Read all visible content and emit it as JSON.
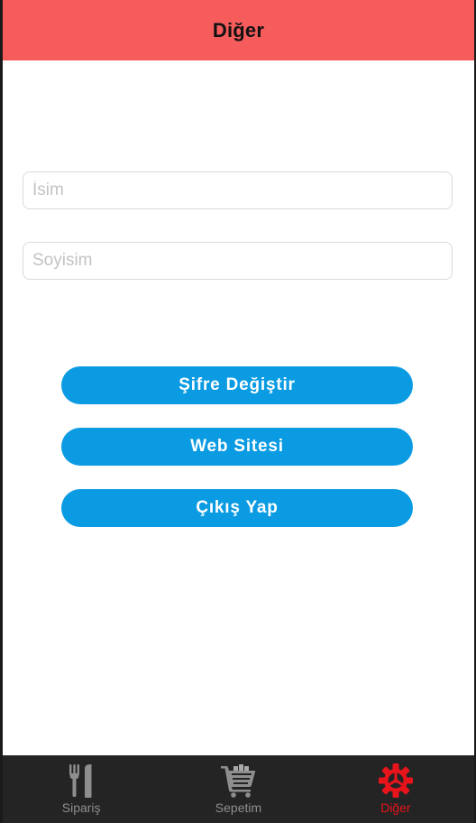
{
  "header": {
    "title": "Diğer"
  },
  "form": {
    "name": {
      "value": "",
      "placeholder": "İsim"
    },
    "surname": {
      "value": "",
      "placeholder": "Soyisim"
    }
  },
  "actions": {
    "change_password_label": "Şifre Değiştir",
    "website_label": "Web Sitesi",
    "logout_label": "Çıkış Yap"
  },
  "tabbar": {
    "items": [
      {
        "label": "Sipariş",
        "icon": "fork-knife-icon",
        "active": false
      },
      {
        "label": "Sepetim",
        "icon": "cart-icon",
        "active": false
      },
      {
        "label": "Diğer",
        "icon": "gear-icon",
        "active": true
      }
    ]
  },
  "colors": {
    "header": "#f65c5c",
    "button": "#0b9be2",
    "tabbar": "#242424",
    "tab_inactive": "#8e8e8e",
    "tab_active": "#e8141b"
  }
}
